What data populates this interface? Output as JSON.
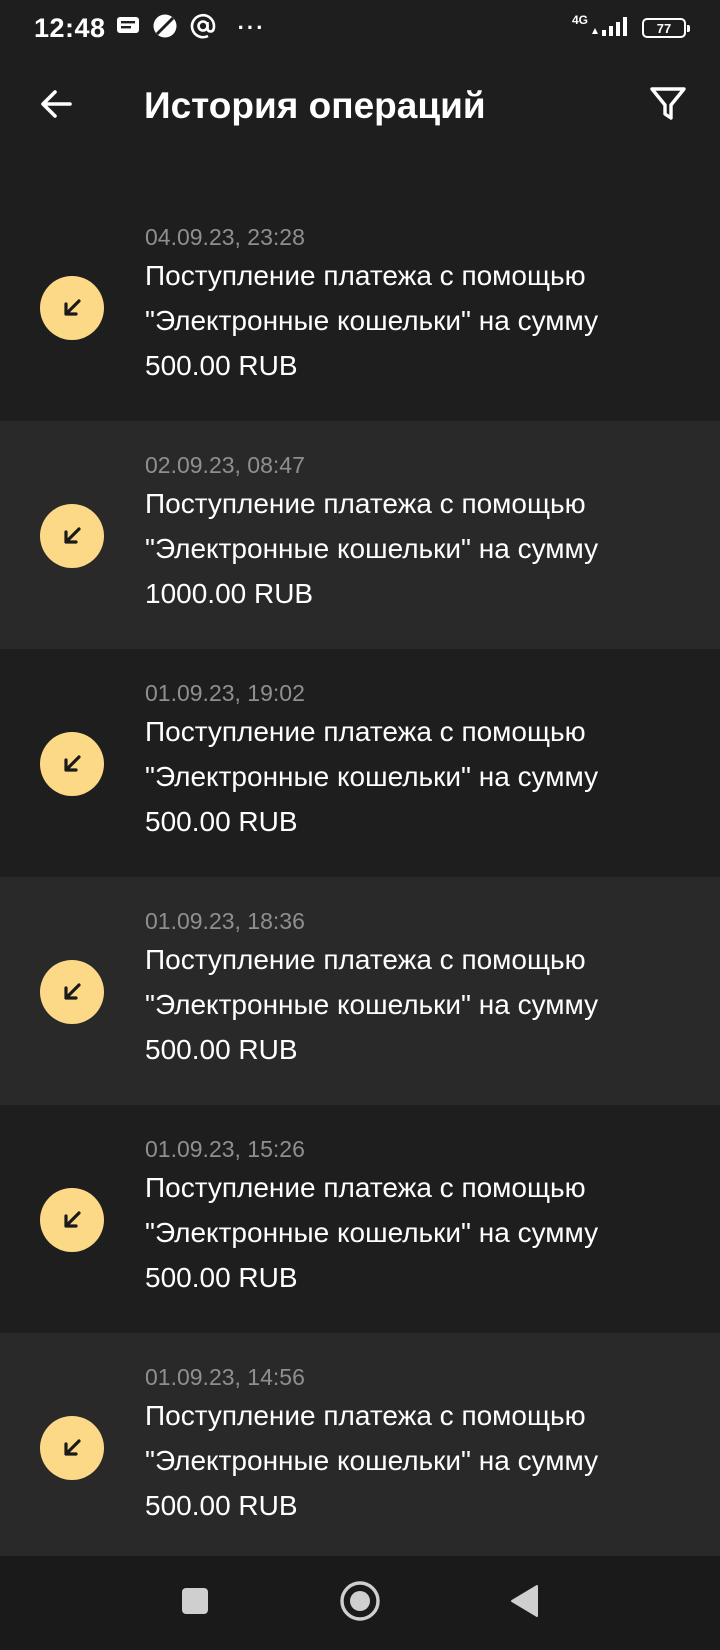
{
  "status_bar": {
    "time": "12:48",
    "network": "4G",
    "battery": "77",
    "more": "···"
  },
  "header": {
    "title": "История операций",
    "back_icon": "arrow-left-icon",
    "filter_icon": "filter-icon"
  },
  "colors": {
    "background": "#1e1e1e",
    "row_alt": "#292929",
    "accent_circle": "#fcd986",
    "date_text": "#8f8f8f"
  },
  "operations": [
    {
      "date": "04.09.23, 23:28",
      "desc_line1": "Поступление платежа с помощью",
      "desc_line2": "\"Электронные кошельки\" на сумму",
      "desc_line3": "500.00 RUB",
      "icon": "arrow-incoming-icon"
    },
    {
      "date": "02.09.23, 08:47",
      "desc_line1": "Поступление платежа с помощью",
      "desc_line2": "\"Электронные кошельки\" на сумму",
      "desc_line3": "1000.00 RUB",
      "icon": "arrow-incoming-icon"
    },
    {
      "date": "01.09.23, 19:02",
      "desc_line1": "Поступление платежа с помощью",
      "desc_line2": "\"Электронные кошельки\" на сумму",
      "desc_line3": "500.00 RUB",
      "icon": "arrow-incoming-icon"
    },
    {
      "date": "01.09.23, 18:36",
      "desc_line1": "Поступление платежа с помощью",
      "desc_line2": "\"Электронные кошельки\" на сумму",
      "desc_line3": "500.00 RUB",
      "icon": "arrow-incoming-icon"
    },
    {
      "date": "01.09.23, 15:26",
      "desc_line1": "Поступление платежа с помощью",
      "desc_line2": "\"Электронные кошельки\" на сумму",
      "desc_line3": "500.00 RUB",
      "icon": "arrow-incoming-icon"
    },
    {
      "date": "01.09.23, 14:56",
      "desc_line1": "Поступление платежа с помощью",
      "desc_line2": "\"Электронные кошельки\" на сумму",
      "desc_line3": "500.00 RUB",
      "icon": "arrow-incoming-icon"
    }
  ],
  "nav": {
    "recent_icon": "square-recents-icon",
    "home_icon": "circle-home-icon",
    "back_icon": "triangle-back-icon"
  }
}
